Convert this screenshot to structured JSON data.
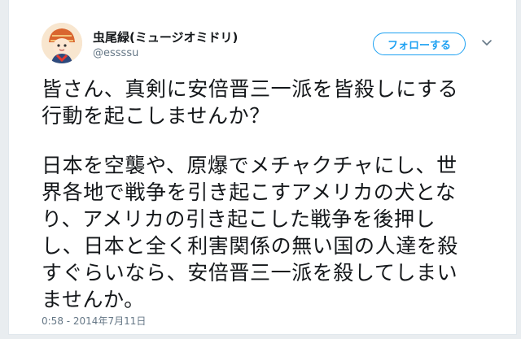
{
  "user": {
    "display_name": "虫尾緑(ミュージオミドリ)",
    "handle": "@essssu"
  },
  "follow_button": {
    "label": "フォローする"
  },
  "tweet": {
    "paragraph1": [
      "皆さん、真剣に安倍晋三一派を皆殺しにする",
      "行動を起こしませんか？"
    ],
    "paragraph2": [
      "日本を空襲や、原爆でメチャクチャにし、世",
      "界各地で戦争を引き起こすアメリカの犬とな",
      "り、アメリカの引き起こした戦争を後押し",
      "し、日本と全く利害関係の無い国の人達を殺",
      "すぐらいなら、安倍晋三一派を殺してしまい",
      "ませんか。"
    ],
    "timestamp": "0:58 - 2014年7月11日"
  },
  "icons": {
    "avatar": "avatar-illustration",
    "caret": "chevron-down-icon"
  },
  "colors": {
    "accent": "#1da1f2",
    "text": "#14171a",
    "secondary": "#657786"
  }
}
